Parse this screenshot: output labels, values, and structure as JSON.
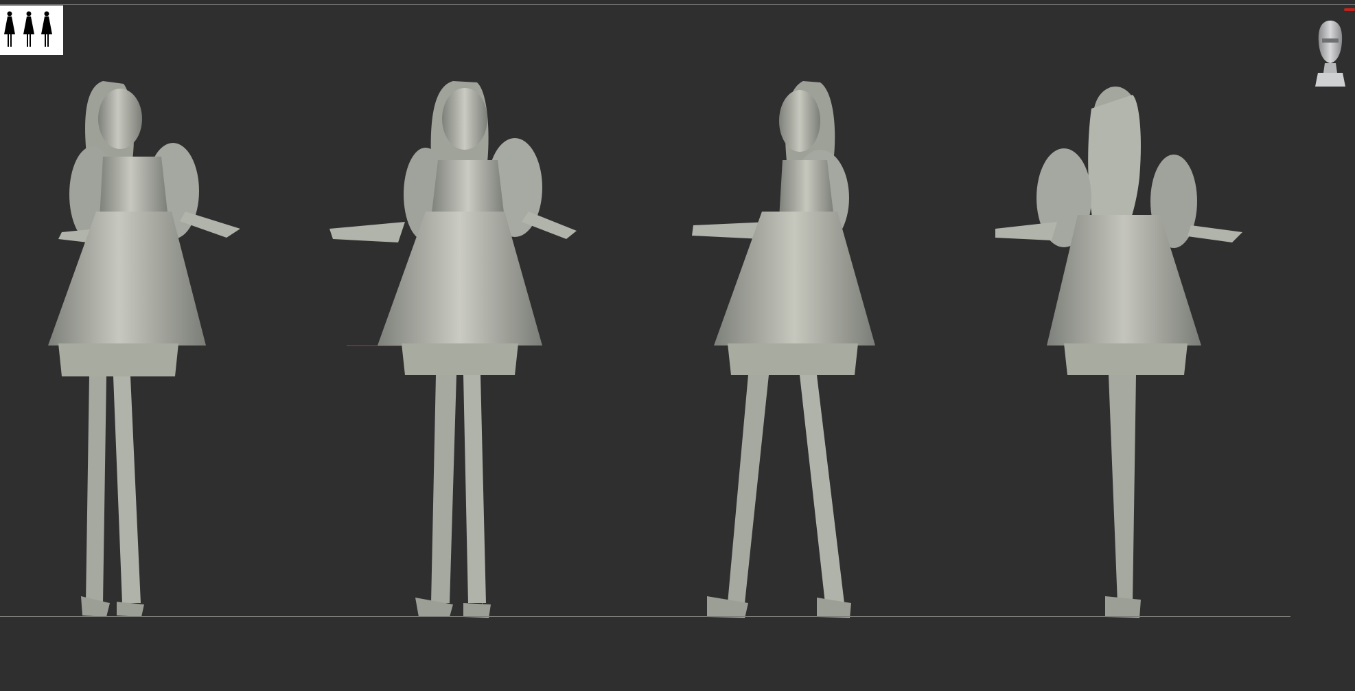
{
  "viewport": {
    "background": "#2f2f30",
    "model_color": "#a7aaa2",
    "ground_line_color": "#7e7f7a"
  },
  "thumbnail": {
    "icon": "silhouette-thumbnail-icon",
    "background": "#ffffff"
  },
  "navigation": {
    "icon": "head-navigation-icon"
  },
  "figures": [
    {
      "view": "front-three-quarter",
      "icon": "model-figure"
    },
    {
      "view": "front",
      "icon": "model-figure"
    },
    {
      "view": "side-three-quarter",
      "icon": "model-figure"
    },
    {
      "view": "back",
      "icon": "model-figure"
    }
  ],
  "axes": {
    "x_color": "#b8332a",
    "y_color": "#3aa34a"
  }
}
